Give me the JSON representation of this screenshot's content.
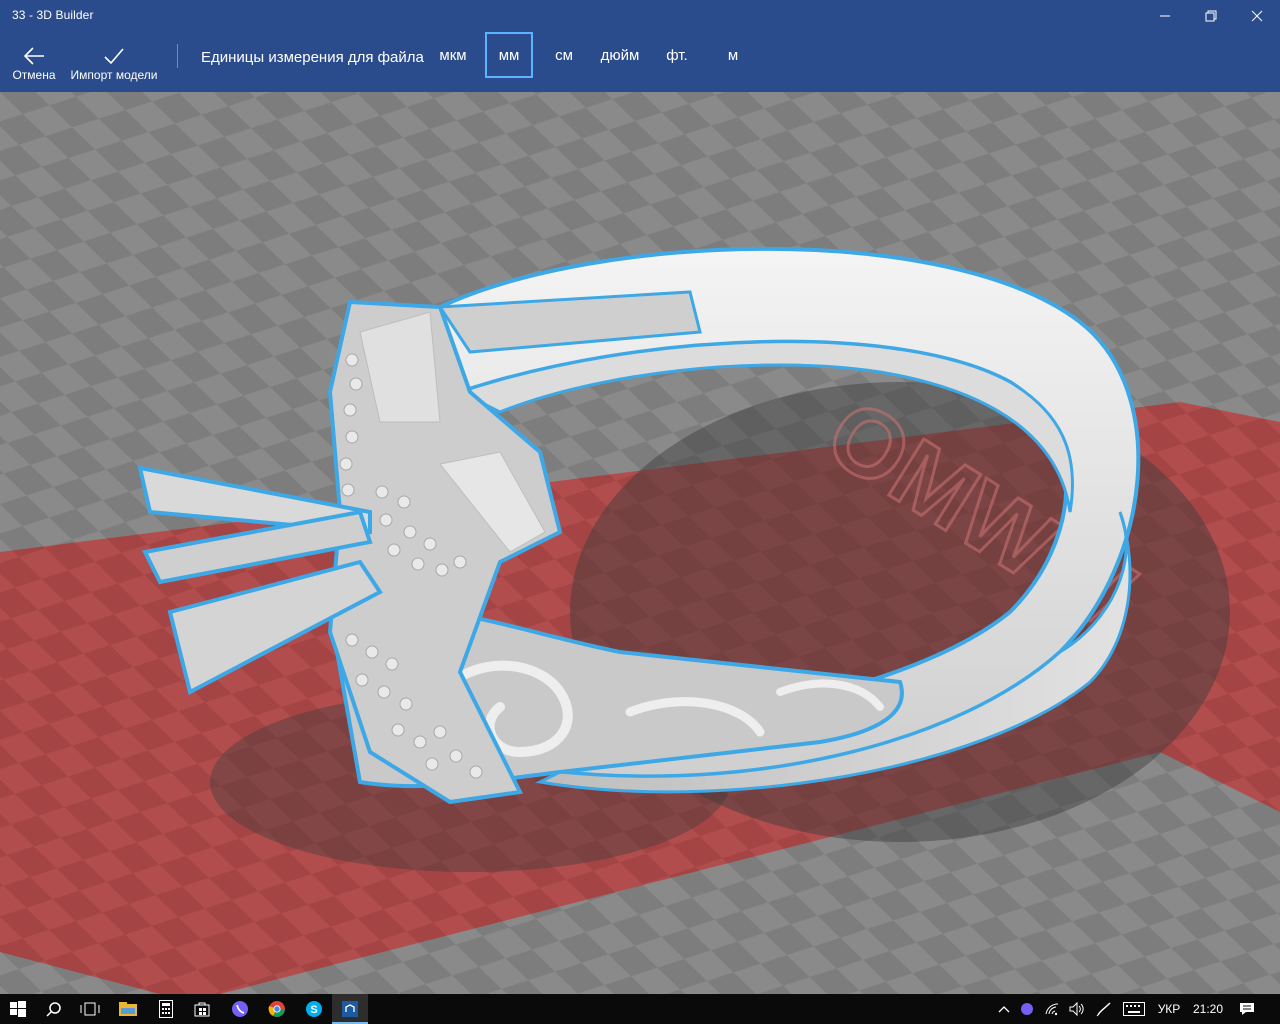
{
  "window": {
    "title": "33 - 3D Builder"
  },
  "commands": {
    "cancel_label": "Отмена",
    "import_label": "Импорт модели"
  },
  "units": {
    "label": "Единицы измерения для файла",
    "options": [
      "мкм",
      "мм",
      "см",
      "дюйм",
      "фт.",
      "м"
    ],
    "selected": "мм"
  },
  "viewport": {
    "accent": "#3ea8e6",
    "plate_color": "#b84a4a",
    "watermark": "OMWW"
  },
  "taskbar": {
    "apps": [
      "start-icon",
      "search-icon",
      "task-view-icon",
      "file-explorer-icon",
      "calculator-icon",
      "store-icon",
      "viber-icon",
      "chrome-icon",
      "skype-icon",
      "3d-builder-icon"
    ],
    "tray": {
      "language": "УКР",
      "time": "21:20"
    }
  }
}
